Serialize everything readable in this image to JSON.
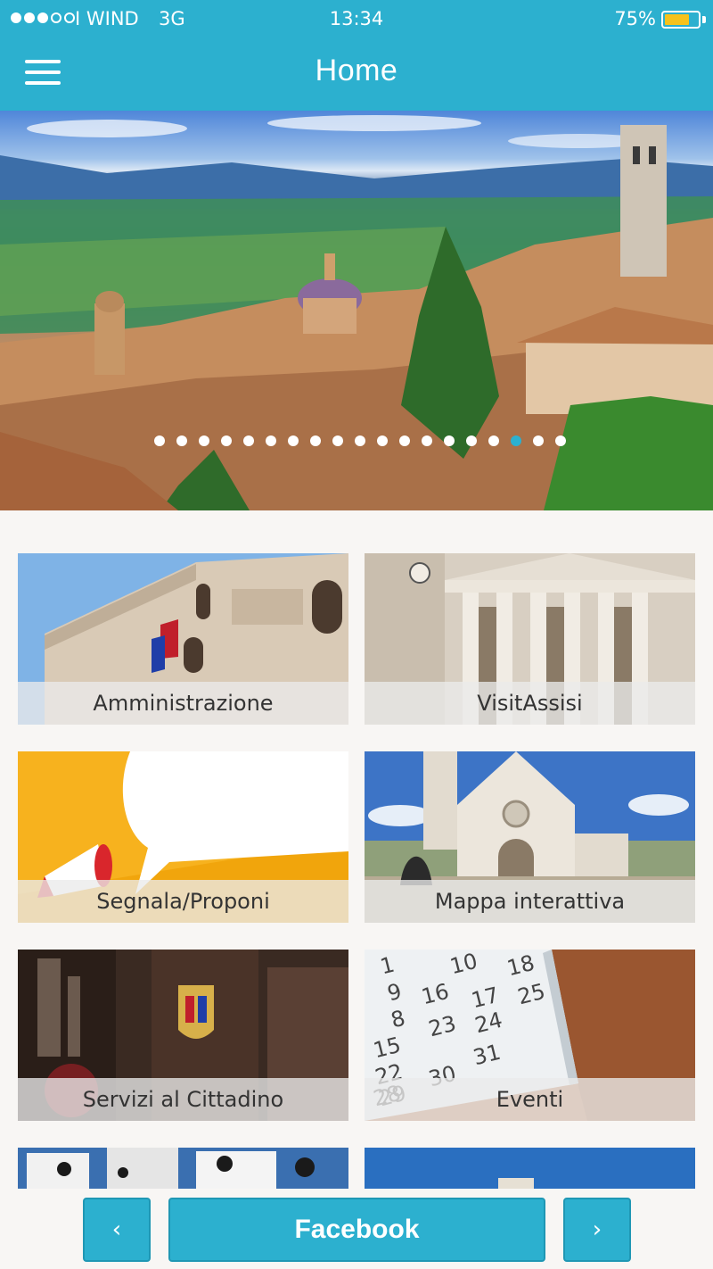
{
  "status_bar": {
    "carrier": "I WIND",
    "network": "3G",
    "time": "13:34",
    "battery": "75%",
    "battery_level": 0.75,
    "signal_bars_filled": 3,
    "signal_bars_total": 5
  },
  "nav": {
    "title": "Home",
    "menu_icon": "hamburger-menu-icon"
  },
  "hero": {
    "image": "assisi-panorama",
    "pager_total": 19,
    "pager_active": 17
  },
  "tiles": [
    {
      "label": "Amministrazione",
      "image": "palazzo-building"
    },
    {
      "label": "VisitAssisi",
      "image": "temple-columns"
    },
    {
      "label": "Segnala/Proponi",
      "image": "megaphone-speech-bubble"
    },
    {
      "label": "Mappa interattiva",
      "image": "basilica"
    },
    {
      "label": "Servizi al Cittadino",
      "image": "city-crest"
    },
    {
      "label": "Eventi",
      "image": "calendar"
    },
    {
      "label": "",
      "image": "dice"
    },
    {
      "label": "",
      "image": "blue-sky"
    }
  ],
  "calendar_numbers": [
    "1",
    "9",
    "10",
    "8",
    "16",
    "17",
    "18",
    "15",
    "23",
    "24",
    "25",
    "22",
    "30",
    "31",
    "29",
    "28"
  ],
  "bottom_bar": {
    "prev": "‹",
    "main": "Facebook",
    "next": "›"
  },
  "colors": {
    "accent": "#2cb0cf",
    "battery": "#f6c21c",
    "tile_band": "#ebebeb",
    "background": "#f8f6f4"
  }
}
